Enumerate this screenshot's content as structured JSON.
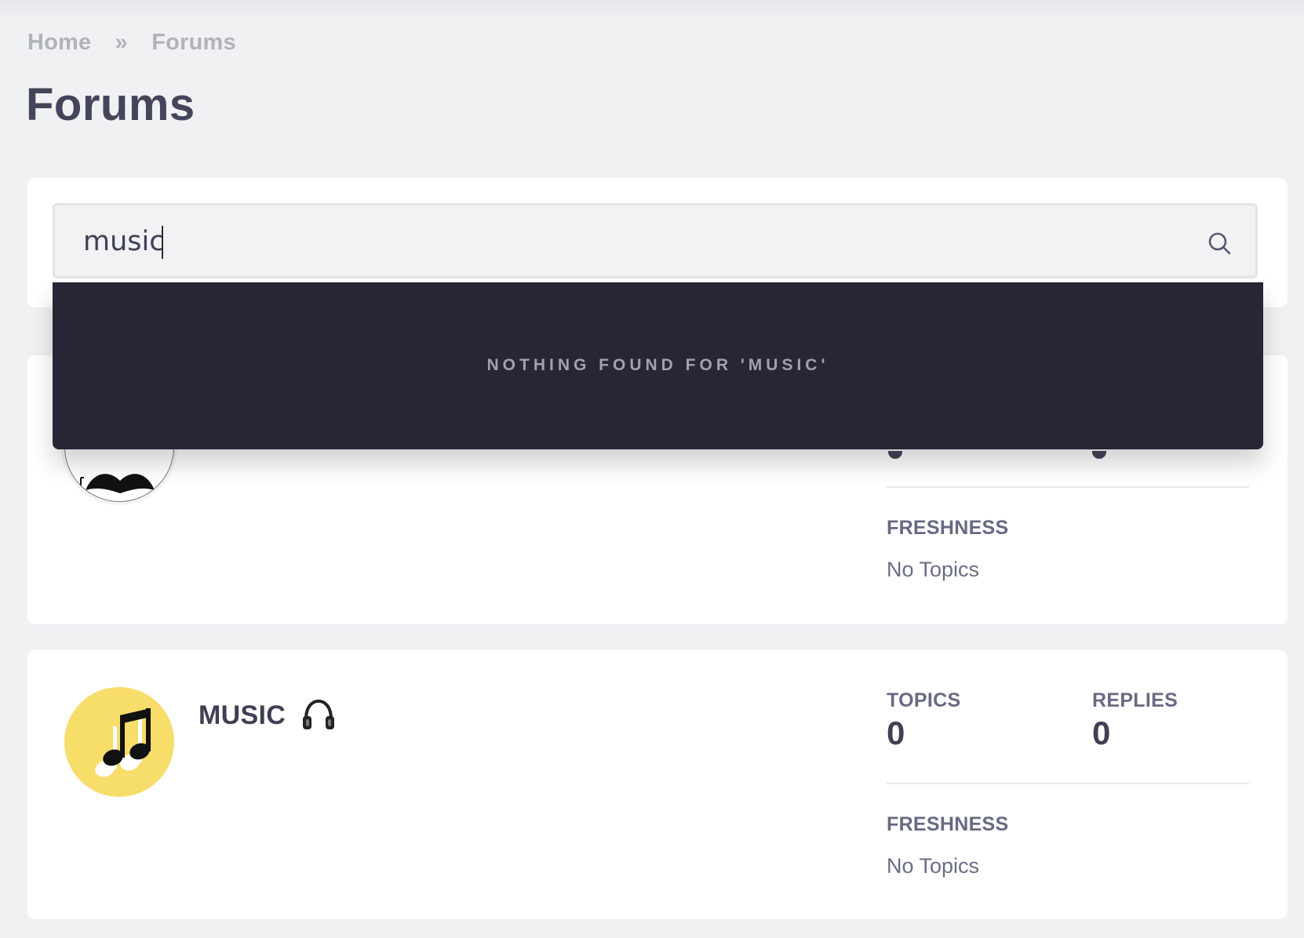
{
  "breadcrumb": {
    "home": "Home",
    "separator": "»",
    "current": "Forums"
  },
  "page_title": "Forums",
  "search": {
    "value": "music",
    "icon": "search-icon",
    "results_message": "NOTHING FOUND FOR 'MUSIC'"
  },
  "forums": [
    {
      "title": "",
      "avatar_icon": "mustache-icon",
      "freshness_label": "FRESHNESS",
      "freshness_value": "No Topics"
    },
    {
      "title": "MUSIC",
      "title_icon": "headphones-icon",
      "avatar_icon": "music-note-icon",
      "topics_label": "TOPICS",
      "topics_value": "0",
      "replies_label": "REPLIES",
      "replies_value": "0",
      "freshness_label": "FRESHNESS",
      "freshness_value": "No Topics"
    }
  ],
  "colors": {
    "background": "#f0f1f3",
    "card": "#ffffff",
    "dropdown": "#262637",
    "music_avatar": "#f7dd69",
    "heading": "#3f4055",
    "muted": "#676a82"
  }
}
